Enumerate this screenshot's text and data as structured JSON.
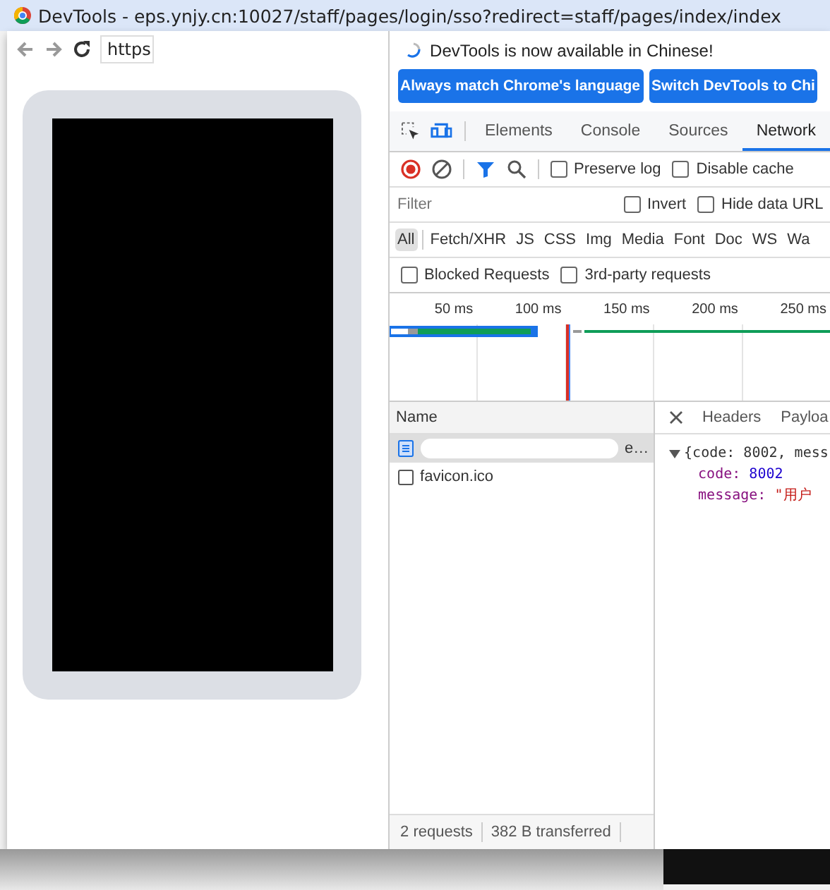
{
  "window": {
    "title": "DevTools - eps.ynjy.cn:10027/staff/pages/login/sso?redirect=staff/pages/index/index"
  },
  "browser": {
    "address": "https"
  },
  "infobar": {
    "message": "DevTools is now available in Chinese!",
    "buttons": [
      "Always match Chrome's language",
      "Switch DevTools to Chi"
    ]
  },
  "tabs": [
    {
      "label": "Elements",
      "selected": false
    },
    {
      "label": "Console",
      "selected": false
    },
    {
      "label": "Sources",
      "selected": false
    },
    {
      "label": "Network",
      "selected": true
    }
  ],
  "toolbar": {
    "recording": true,
    "checkboxes": [
      {
        "label": "Preserve log",
        "checked": false
      },
      {
        "label": "Disable cache",
        "checked": false
      }
    ]
  },
  "filter": {
    "placeholder": "Filter",
    "checkboxes": [
      {
        "label": "Invert",
        "checked": false
      },
      {
        "label": "Hide data URL",
        "checked": false
      }
    ]
  },
  "types": [
    {
      "label": "All",
      "selected": true
    },
    {
      "label": "Fetch/XHR",
      "selected": false
    },
    {
      "label": "JS",
      "selected": false
    },
    {
      "label": "CSS",
      "selected": false
    },
    {
      "label": "Img",
      "selected": false
    },
    {
      "label": "Media",
      "selected": false
    },
    {
      "label": "Font",
      "selected": false
    },
    {
      "label": "Doc",
      "selected": false
    },
    {
      "label": "WS",
      "selected": false
    },
    {
      "label": "Wa",
      "selected": false
    }
  ],
  "extra_filters": [
    {
      "label": "Blocked Requests",
      "checked": false
    },
    {
      "label": "3rd-party requests",
      "checked": false
    }
  ],
  "timeline": {
    "ticks": [
      "50 ms",
      "100 ms",
      "150 ms",
      "200 ms",
      "250 ms"
    ]
  },
  "requests": {
    "column": "Name",
    "rows": [
      {
        "kind": "document",
        "name": "e…",
        "selected": true
      },
      {
        "kind": "file",
        "name": "favicon.ico",
        "selected": false
      }
    ]
  },
  "details": {
    "tabs": [
      {
        "label": "Headers",
        "selected": false
      },
      {
        "label": "Payloa",
        "selected": false
      }
    ],
    "summary": "{code: 8002, mess",
    "fields": [
      {
        "key": "code:",
        "value": "8002",
        "kind": "number"
      },
      {
        "key": "message:",
        "value": "\"用户",
        "kind": "string"
      }
    ]
  },
  "status_bar": [
    "2 requests",
    "382 B transferred"
  ]
}
